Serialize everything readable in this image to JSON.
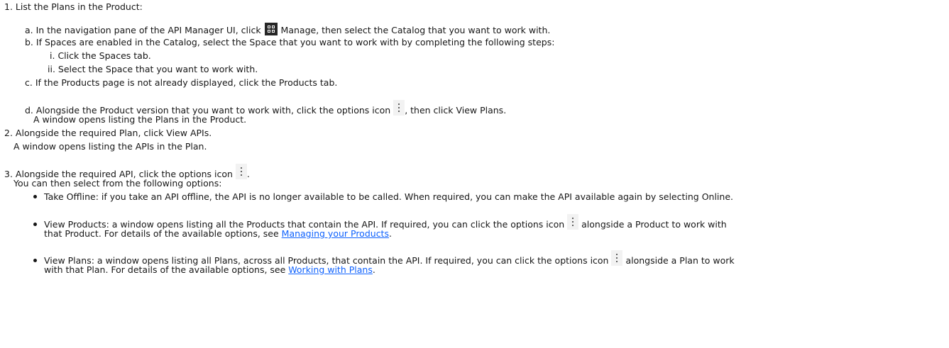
{
  "step1": {
    "num": "1.",
    "text": "List the Plans in the Product:",
    "a": {
      "marker": "a.",
      "before": "In the navigation pane of the API Manager UI, click ",
      "after": " Manage, then select the Catalog that you want to work with."
    },
    "b": {
      "marker": "b.",
      "text": "If Spaces are enabled in the Catalog, select the Space that you want to work with by completing the following steps:",
      "i": {
        "marker": "i.",
        "text": "Click the Spaces tab."
      },
      "ii": {
        "marker": "ii.",
        "text": "Select the Space that you want to work with."
      }
    },
    "c": {
      "marker": "c.",
      "text": "If the Products page is not already displayed, click the Products tab."
    },
    "d": {
      "marker": "d.",
      "before": "Alongside the Product version that you want to work with, click the options icon ",
      "after": ", then click View Plans.",
      "result": "A window opens listing the Plans in the Product."
    }
  },
  "step2": {
    "num": "2.",
    "text": "Alongside the required Plan, click View APIs.",
    "result": "A window opens listing the APIs in the Plan."
  },
  "step3": {
    "num": "3.",
    "before": "Alongside the required API, click the options icon ",
    "after": ".",
    "intro": "You can then select from the following options:",
    "options": {
      "offline": "Take Offline: if you take an API offline, the API is no longer available to be called. When required, you can make the API available again by selecting Online.",
      "products": {
        "line1_before": "View Products: a window opens listing all the Products that contain the API. If required, you can click the options icon ",
        "line1_after": " alongside a Product to work with",
        "line2_before": "that Product. For details of the available options, see ",
        "link": "Managing your Products",
        "line2_after": "."
      },
      "plans": {
        "line1_before": "View Plans: a window opens listing all Plans, across all Products, that contain the API. If required, you can click the options icon ",
        "line1_after": " alongside a Plan to work",
        "line2_before": "with that Plan. For details of the available options, see ",
        "link": "Working with Plans",
        "line2_after": "."
      }
    }
  },
  "icons": {
    "manage": "grid-icon",
    "options": "overflow-menu-icon"
  }
}
